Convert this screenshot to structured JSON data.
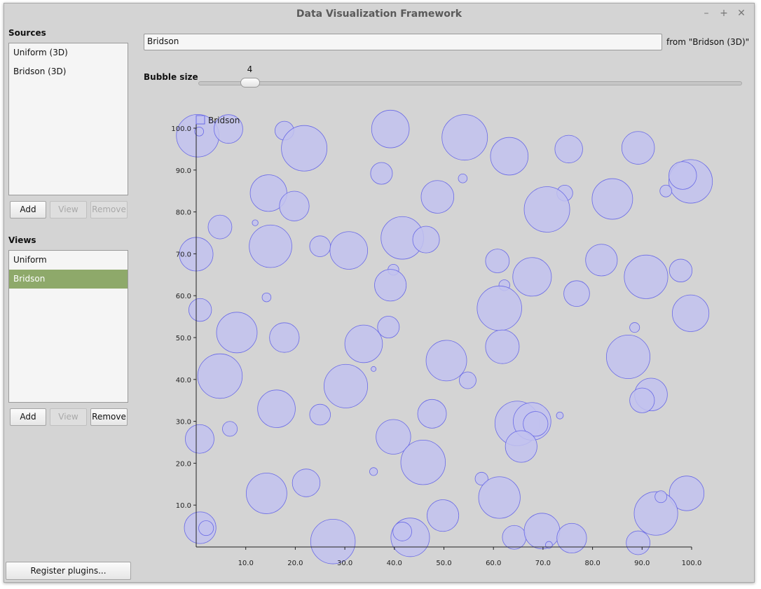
{
  "window": {
    "title": "Data Visualization Framework",
    "controls": {
      "minimize": "–",
      "maximize": "+",
      "close": "✕"
    }
  },
  "sources": {
    "label": "Sources",
    "items": [
      "Uniform (3D)",
      "Bridson (3D)"
    ],
    "buttons": {
      "add": "Add",
      "view": "View",
      "remove": "Remove"
    }
  },
  "views": {
    "label": "Views",
    "items": [
      "Uniform",
      "Bridson"
    ],
    "selected_index": 1,
    "buttons": {
      "add": "Add",
      "view": "View",
      "remove": "Remove"
    }
  },
  "register_button": "Register plugins...",
  "view_name_input": "Bridson",
  "from_label": "from \"Bridson (3D)\"",
  "bubble_size": {
    "label": "Bubble size",
    "value": 4,
    "min": 0,
    "max": 50
  },
  "colors": {
    "bubble_fill": "#c2c2ef",
    "bubble_stroke": "#6a6ae6",
    "selection": "#8ea96a",
    "background": "#d4d4d4"
  },
  "chart_data": {
    "type": "scatter",
    "subtype": "bubble",
    "legend": [
      "Bridson"
    ],
    "legend_position": "top-left",
    "grid": false,
    "xlim": [
      0,
      100
    ],
    "ylim": [
      0,
      100
    ],
    "x_ticks": [
      "10.0",
      "20.0",
      "30.0",
      "40.0",
      "50.0",
      "60.0",
      "70.0",
      "80.0",
      "90.0",
      "100.0"
    ],
    "y_ticks": [
      "10.0",
      "20.0",
      "30.0",
      "40.0",
      "50.0",
      "60.0",
      "70.0",
      "80.0",
      "90.0",
      "100.0"
    ],
    "series": [
      {
        "name": "Bridson",
        "points": [
          {
            "x": 0.3,
            "y": 98.2,
            "r": 4.3
          },
          {
            "x": 0.6,
            "y": 99.2,
            "r": 0.9
          },
          {
            "x": 6.5,
            "y": 99.8,
            "r": 2.9
          },
          {
            "x": 17.8,
            "y": 99.4,
            "r": 1.9
          },
          {
            "x": 21.8,
            "y": 95.2,
            "r": 4.6
          },
          {
            "x": 39.2,
            "y": 99.8,
            "r": 3.8
          },
          {
            "x": 54.2,
            "y": 97.8,
            "r": 4.6
          },
          {
            "x": 63.2,
            "y": 93.3,
            "r": 3.8
          },
          {
            "x": 75.2,
            "y": 95.0,
            "r": 2.8
          },
          {
            "x": 89.2,
            "y": 95.3,
            "r": 3.3
          },
          {
            "x": 99.8,
            "y": 87.3,
            "r": 4.4
          },
          {
            "x": 98.2,
            "y": 88.7,
            "r": 2.8
          },
          {
            "x": 94.8,
            "y": 85.0,
            "r": 1.2
          },
          {
            "x": 84.0,
            "y": 83.1,
            "r": 4.1
          },
          {
            "x": 74.4,
            "y": 84.5,
            "r": 1.6
          },
          {
            "x": 70.8,
            "y": 80.6,
            "r": 4.6
          },
          {
            "x": 53.8,
            "y": 88.0,
            "r": 0.9
          },
          {
            "x": 37.4,
            "y": 89.2,
            "r": 2.2
          },
          {
            "x": 48.7,
            "y": 83.6,
            "r": 3.3
          },
          {
            "x": 14.6,
            "y": 84.5,
            "r": 3.7
          },
          {
            "x": 19.8,
            "y": 81.4,
            "r": 3.0
          },
          {
            "x": 4.8,
            "y": 76.4,
            "r": 2.4
          },
          {
            "x": 11.9,
            "y": 77.4,
            "r": 0.6
          },
          {
            "x": 15.0,
            "y": 71.8,
            "r": 4.3
          },
          {
            "x": 25.0,
            "y": 71.8,
            "r": 2.1
          },
          {
            "x": 30.8,
            "y": 70.8,
            "r": 3.8
          },
          {
            "x": 41.6,
            "y": 73.8,
            "r": 4.3
          },
          {
            "x": 46.4,
            "y": 73.4,
            "r": 2.7
          },
          {
            "x": 0.0,
            "y": 69.9,
            "r": 3.4
          },
          {
            "x": 60.8,
            "y": 68.3,
            "r": 2.4
          },
          {
            "x": 67.8,
            "y": 64.5,
            "r": 3.9
          },
          {
            "x": 81.8,
            "y": 68.5,
            "r": 3.2
          },
          {
            "x": 90.8,
            "y": 64.5,
            "r": 4.4
          },
          {
            "x": 97.8,
            "y": 66.0,
            "r": 2.3
          },
          {
            "x": 39.8,
            "y": 66.2,
            "r": 1.1
          },
          {
            "x": 39.2,
            "y": 62.5,
            "r": 3.2
          },
          {
            "x": 62.2,
            "y": 62.5,
            "r": 1.1
          },
          {
            "x": 76.8,
            "y": 60.5,
            "r": 2.6
          },
          {
            "x": 14.2,
            "y": 59.6,
            "r": 0.9
          },
          {
            "x": 61.2,
            "y": 57.0,
            "r": 4.5
          },
          {
            "x": 0.8,
            "y": 56.6,
            "r": 2.3
          },
          {
            "x": 99.8,
            "y": 55.8,
            "r": 3.7
          },
          {
            "x": 8.2,
            "y": 51.2,
            "r": 4.1
          },
          {
            "x": 17.8,
            "y": 50.0,
            "r": 3.0
          },
          {
            "x": 38.8,
            "y": 52.5,
            "r": 2.2
          },
          {
            "x": 33.8,
            "y": 48.5,
            "r": 3.8
          },
          {
            "x": 61.8,
            "y": 47.8,
            "r": 3.4
          },
          {
            "x": 88.5,
            "y": 52.4,
            "r": 1.0
          },
          {
            "x": 87.2,
            "y": 45.4,
            "r": 4.4
          },
          {
            "x": 50.5,
            "y": 44.5,
            "r": 4.1
          },
          {
            "x": 35.8,
            "y": 42.5,
            "r": 0.5
          },
          {
            "x": 4.8,
            "y": 40.8,
            "r": 4.5
          },
          {
            "x": 30.2,
            "y": 38.4,
            "r": 4.4
          },
          {
            "x": 54.8,
            "y": 39.8,
            "r": 1.7
          },
          {
            "x": 91.8,
            "y": 36.4,
            "r": 3.3
          },
          {
            "x": 90.0,
            "y": 35.0,
            "r": 2.5
          },
          {
            "x": 16.2,
            "y": 33.0,
            "r": 3.8
          },
          {
            "x": 25.0,
            "y": 31.6,
            "r": 2.1
          },
          {
            "x": 47.6,
            "y": 31.8,
            "r": 2.9
          },
          {
            "x": 64.8,
            "y": 29.5,
            "r": 4.5
          },
          {
            "x": 67.8,
            "y": 30.0,
            "r": 3.8
          },
          {
            "x": 68.5,
            "y": 29.4,
            "r": 2.5
          },
          {
            "x": 73.4,
            "y": 31.4,
            "r": 0.7
          },
          {
            "x": 6.8,
            "y": 28.2,
            "r": 1.5
          },
          {
            "x": 39.8,
            "y": 26.3,
            "r": 3.5
          },
          {
            "x": 0.7,
            "y": 25.8,
            "r": 2.9
          },
          {
            "x": 65.6,
            "y": 24.0,
            "r": 3.2
          },
          {
            "x": 45.8,
            "y": 20.2,
            "r": 4.5
          },
          {
            "x": 35.8,
            "y": 18.0,
            "r": 0.8
          },
          {
            "x": 57.6,
            "y": 16.3,
            "r": 1.3
          },
          {
            "x": 14.2,
            "y": 12.8,
            "r": 4.1
          },
          {
            "x": 22.2,
            "y": 15.3,
            "r": 2.8
          },
          {
            "x": 61.2,
            "y": 11.8,
            "r": 4.2
          },
          {
            "x": 99.0,
            "y": 12.8,
            "r": 3.5
          },
          {
            "x": 92.8,
            "y": 8.0,
            "r": 4.4
          },
          {
            "x": 93.8,
            "y": 12.0,
            "r": 1.2
          },
          {
            "x": 49.8,
            "y": 7.5,
            "r": 3.2
          },
          {
            "x": 0.8,
            "y": 4.6,
            "r": 3.2
          },
          {
            "x": 2.0,
            "y": 4.5,
            "r": 1.5
          },
          {
            "x": 27.6,
            "y": 1.3,
            "r": 4.5
          },
          {
            "x": 43.2,
            "y": 2.3,
            "r": 3.9
          },
          {
            "x": 41.6,
            "y": 3.7,
            "r": 1.9
          },
          {
            "x": 64.2,
            "y": 2.3,
            "r": 2.4
          },
          {
            "x": 69.8,
            "y": 3.8,
            "r": 3.6
          },
          {
            "x": 71.2,
            "y": 0.5,
            "r": 0.7
          },
          {
            "x": 75.8,
            "y": 2.1,
            "r": 3.0
          },
          {
            "x": 89.2,
            "y": 1.0,
            "r": 2.4
          }
        ]
      }
    ]
  }
}
